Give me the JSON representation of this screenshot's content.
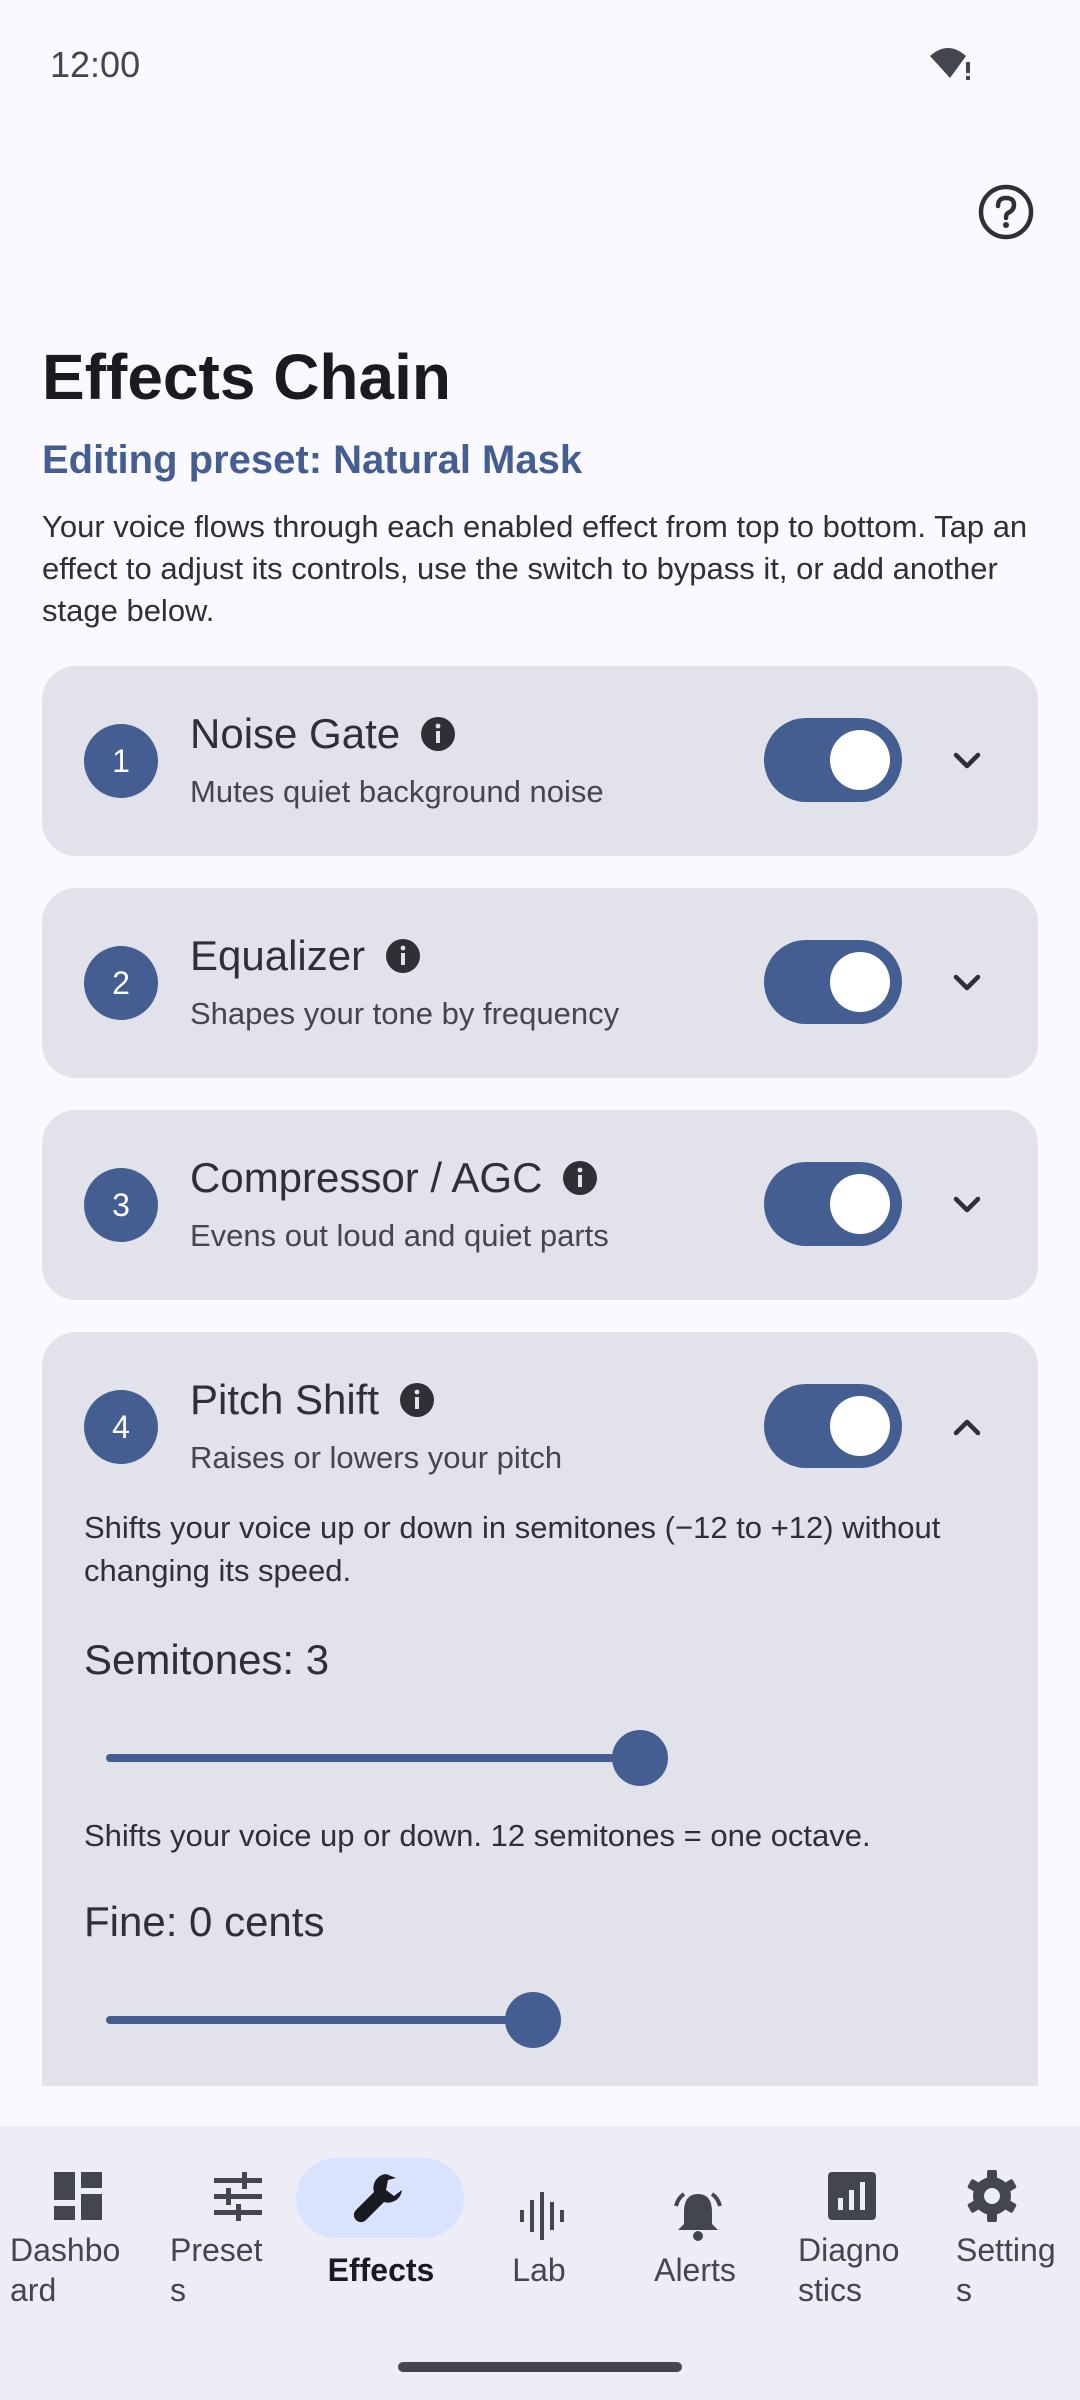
{
  "status_bar": {
    "time": "12:00"
  },
  "page": {
    "title": "Effects Chain",
    "preset_line": "Editing preset: Natural Mask",
    "intro": "Your voice flows through each enabled effect from top to bottom. Tap an effect to adjust its controls, use the switch to bypass it, or add another stage below."
  },
  "effects": [
    {
      "number": "1",
      "name": "Noise Gate",
      "subtitle": "Mutes quiet background noise",
      "enabled": true,
      "expanded": false
    },
    {
      "number": "2",
      "name": "Equalizer",
      "subtitle": "Shapes your tone by frequency",
      "enabled": true,
      "expanded": false
    },
    {
      "number": "3",
      "name": "Compressor / AGC",
      "subtitle": "Evens out loud and quiet parts",
      "enabled": true,
      "expanded": false
    },
    {
      "number": "4",
      "name": "Pitch Shift",
      "subtitle": "Raises or lowers your pitch",
      "enabled": true,
      "expanded": true,
      "description": "Shifts your voice up or down in semitones (−12 to +12) without changing its speed.",
      "controls": [
        {
          "label": "Semitones: 3",
          "value": 3,
          "min": -12,
          "max": 12,
          "hint": "Shifts your voice up or down. 12 semitones = one octave."
        },
        {
          "label": "Fine: 0 cents",
          "value": 0,
          "min": -100,
          "max": 100
        }
      ]
    }
  ],
  "nav": {
    "items": [
      {
        "label": "Dashbo\nard",
        "icon": "dashboard-icon"
      },
      {
        "label": "Preset\ns",
        "icon": "tune-icon"
      },
      {
        "label": "Effects",
        "icon": "wrench-icon",
        "active": true
      },
      {
        "label": "Lab",
        "icon": "waveform-icon"
      },
      {
        "label": "Alerts",
        "icon": "bell-icon"
      },
      {
        "label": "Diagno\nstics",
        "icon": "chart-icon"
      },
      {
        "label": "Setting\ns",
        "icon": "gear-icon"
      }
    ]
  },
  "colors": {
    "accent": "#445e91",
    "card": "#e2e2ea",
    "background": "#f9f9ff",
    "nav_active": "#d9e2ff"
  }
}
